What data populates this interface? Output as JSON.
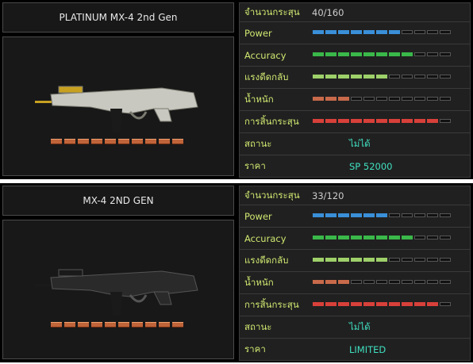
{
  "weapons": [
    {
      "name": "PLATINUM MX-4 2nd Gen",
      "finish": "platinum",
      "stats": {
        "ammo_label": "จำนวนกระสุน",
        "ammo_value": "40/160",
        "power_label": "Power",
        "power_level": 7,
        "accuracy_label": "Accuracy",
        "accuracy_level": 8,
        "recoil_label": "แรงดีดกลับ",
        "recoil_level": 6,
        "weight_label": "น้ำหนัก",
        "weight_level": 3,
        "mag_label": "การสิ้นกระสุน",
        "mag_level": 10,
        "status_label": "สถานะ",
        "status_value": "ไม่ได้",
        "price_label": "ราคา",
        "price_value": "SP 52000"
      }
    },
    {
      "name": "MX-4 2ND GEN",
      "finish": "black",
      "stats": {
        "ammo_label": "จำนวนกระสุน",
        "ammo_value": "33/120",
        "power_label": "Power",
        "power_level": 6,
        "accuracy_label": "Accuracy",
        "accuracy_level": 8,
        "recoil_label": "แรงดีดกลับ",
        "recoil_level": 6,
        "weight_label": "น้ำหนัก",
        "weight_level": 3,
        "mag_label": "การสิ้นกระสุน",
        "mag_level": 10,
        "status_label": "สถานะ",
        "status_value": "ไม่ได้",
        "price_label": "ราคา",
        "price_value": "LIMITED"
      }
    }
  ],
  "bar_segments": 11,
  "ammo_icons": 10,
  "colors": {
    "power": "#3a8fd8",
    "accuracy": "#3ab84a",
    "recoil": "#9ed06a",
    "weight": "#c86a4a",
    "mag": "#d8403a",
    "label": "#cfe870",
    "status": "#40e0c0"
  }
}
